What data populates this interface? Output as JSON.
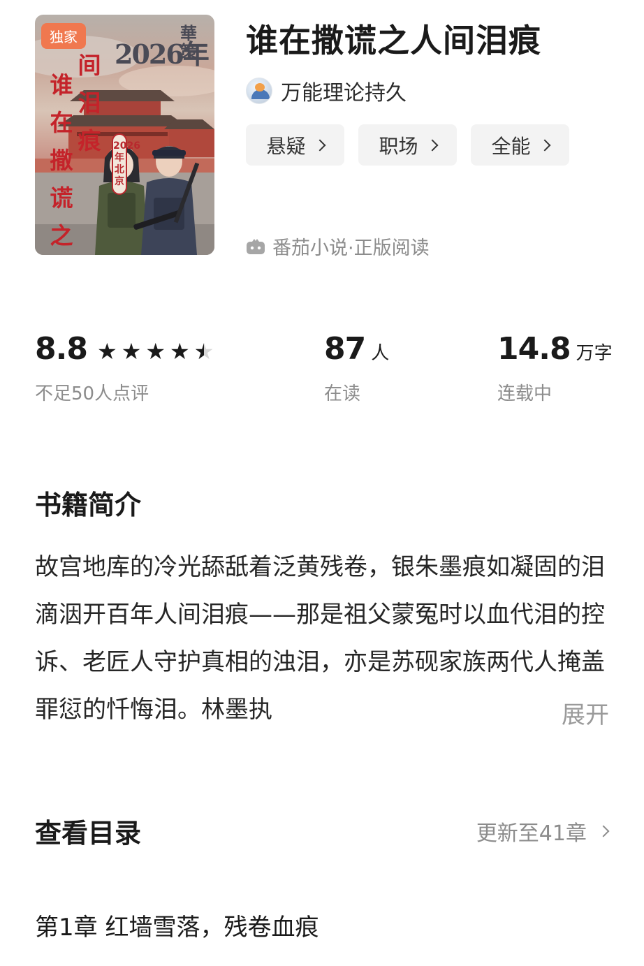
{
  "cover": {
    "badge": "独家",
    "year_text": "2026年",
    "publisher_text": "華策",
    "title_chars_a": "谁在撒谎之人",
    "title_chars_b": "间泪痕",
    "subline": "2026年北京"
  },
  "book": {
    "title": "谁在撒谎之人间泪痕",
    "author": "万能理论持久"
  },
  "tags": [
    {
      "label": "悬疑"
    },
    {
      "label": "职场"
    },
    {
      "label": "全能"
    }
  ],
  "source": {
    "label": "番茄小说·正版阅读",
    "icon": "tomato-app-icon"
  },
  "stats": {
    "rating": {
      "value": "8.8",
      "stars": 4.5,
      "label": "不足50人点评"
    },
    "readers": {
      "value": "87",
      "unit": "人",
      "label": "在读"
    },
    "words": {
      "value": "14.8",
      "unit": "万字",
      "label": "连载中"
    }
  },
  "intro": {
    "heading": "书籍简介",
    "text": "故宫地库的冷光舔舐着泛黄残卷，银朱墨痕如凝固的泪滴洇开百年人间泪痕——那是祖父蒙冤时以血代泪的控诉、老匠人守护真相的浊泪，亦是苏砚家族两代人掩盖罪愆的忏悔泪。林墨执",
    "expand_label": "展开"
  },
  "catalog": {
    "heading": "查看目录",
    "update_label": "更新至41章",
    "first_chapter": "第1章 红墙雪落，残卷血痕"
  },
  "colors": {
    "badge": "#f0784f",
    "cover_title": "#c4232a",
    "muted_text": "#8c8c8c",
    "tag_bg": "#f3f3f3"
  }
}
